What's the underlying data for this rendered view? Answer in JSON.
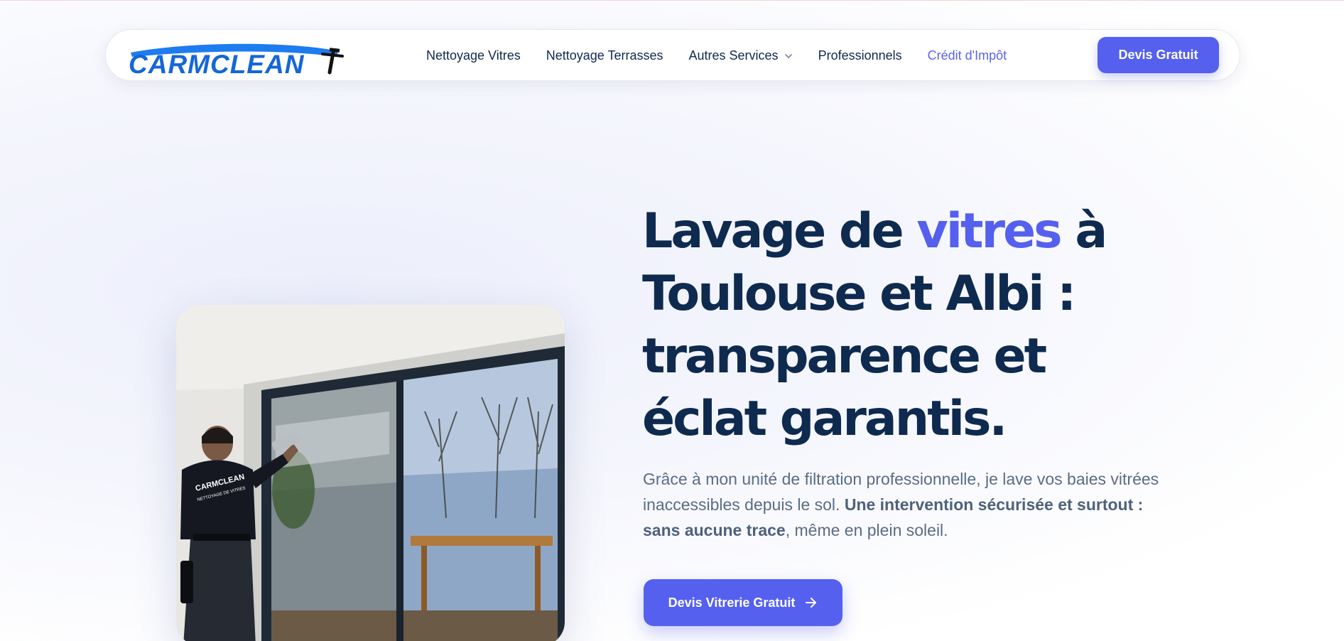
{
  "brand": {
    "name": "CARMCLEAN",
    "color": "#1467d6"
  },
  "nav": {
    "links": [
      {
        "label": "Nettoyage Vitres"
      },
      {
        "label": "Nettoyage Terrasses"
      },
      {
        "label": "Autres Services",
        "icon": "chevron-down-icon"
      },
      {
        "label": "Professionnels"
      },
      {
        "label": "Crédit d'Impôt",
        "active": true
      }
    ],
    "cta": "Devis Gratuit"
  },
  "hero": {
    "headline": {
      "part1": "Lavage de ",
      "highlight": "vitres",
      "part2": " à Toulouse et Albi : transparence et éclat garantis."
    },
    "lead": {
      "text1": "Grâce à mon unité de filtration professionnelle, je lave vos baies vitrées inaccessibles depuis le sol. ",
      "bold": "Une intervention sécurisée et surtout : sans aucune trace",
      "text2": ", même en plein soleil."
    },
    "cta": "Devis Vitrerie Gratuit",
    "cta_icon": "arrow-right-icon",
    "photo": {
      "shirt_line1": "CARMCLEAN",
      "shirt_line2": "NETTOYAGE DE VITRES"
    }
  },
  "colors": {
    "accent": "#5560ee",
    "heading": "#0f2a4f",
    "body": "#5a6c86"
  }
}
